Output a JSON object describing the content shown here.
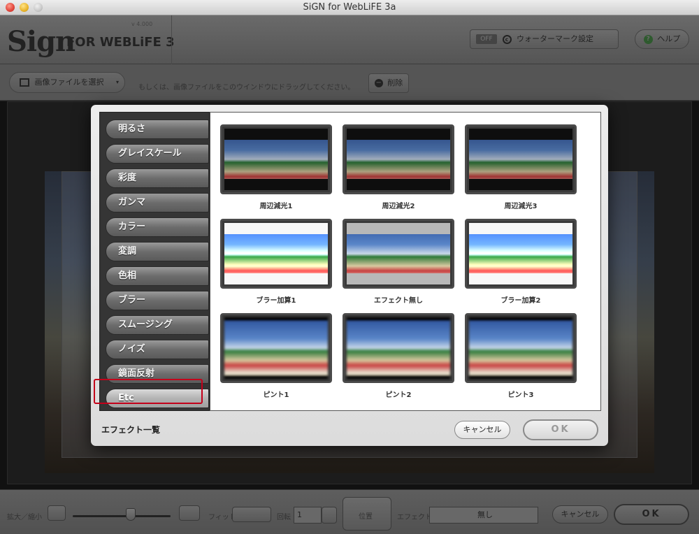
{
  "window": {
    "title": "SiGN for WebLiFE 3a"
  },
  "header": {
    "logo": "Sign",
    "logo_sub": "FOR WEBLiFE 3",
    "version": "v 4.000",
    "watermark_badge": "OFF",
    "watermark_label": "ウォーターマーク設定",
    "help_label": "ヘルプ"
  },
  "toolbar": {
    "select_file_label": "画像ファイルを選択",
    "drag_hint": "もしくは、画像ファイルをこのウインドウにドラッグしてください。",
    "delete_label": "削除"
  },
  "bottombar": {
    "zoom_label": "拡大／縮小",
    "fit_label": "フィット",
    "rotate_label": "回転",
    "rotate_value": "1",
    "position_label": "位置",
    "effect_label": "エフェクト",
    "effect_value": "無し",
    "cancel_label": "キャンセル",
    "ok_label": "OK"
  },
  "dialog": {
    "title": "エフェクト一覧",
    "cancel_label": "キャンセル",
    "ok_label": "OK",
    "categories": [
      "明るさ",
      "グレイスケール",
      "彩度",
      "ガンマ",
      "カラー",
      "変調",
      "色相",
      "ブラー",
      "スムージング",
      "ノイズ",
      "鏡面反射",
      "Etc"
    ],
    "selected_category": "Etc",
    "effects": [
      {
        "label": "周辺減光1",
        "style": "vignette"
      },
      {
        "label": "周辺減光2",
        "style": "vignette"
      },
      {
        "label": "周辺減光3",
        "style": "vignette"
      },
      {
        "label": "ブラー加算1",
        "style": "bright"
      },
      {
        "label": "エフェクト無し",
        "style": "none"
      },
      {
        "label": "ブラー加算2",
        "style": "bright"
      },
      {
        "label": "ピント1",
        "style": "focus"
      },
      {
        "label": "ピント2",
        "style": "focus"
      },
      {
        "label": "ピント3",
        "style": "focus"
      }
    ]
  },
  "colors": {
    "selection_outline": "#c4001a",
    "sidebar_bg": "#353535",
    "dialog_bg": "#e4e4e4"
  }
}
